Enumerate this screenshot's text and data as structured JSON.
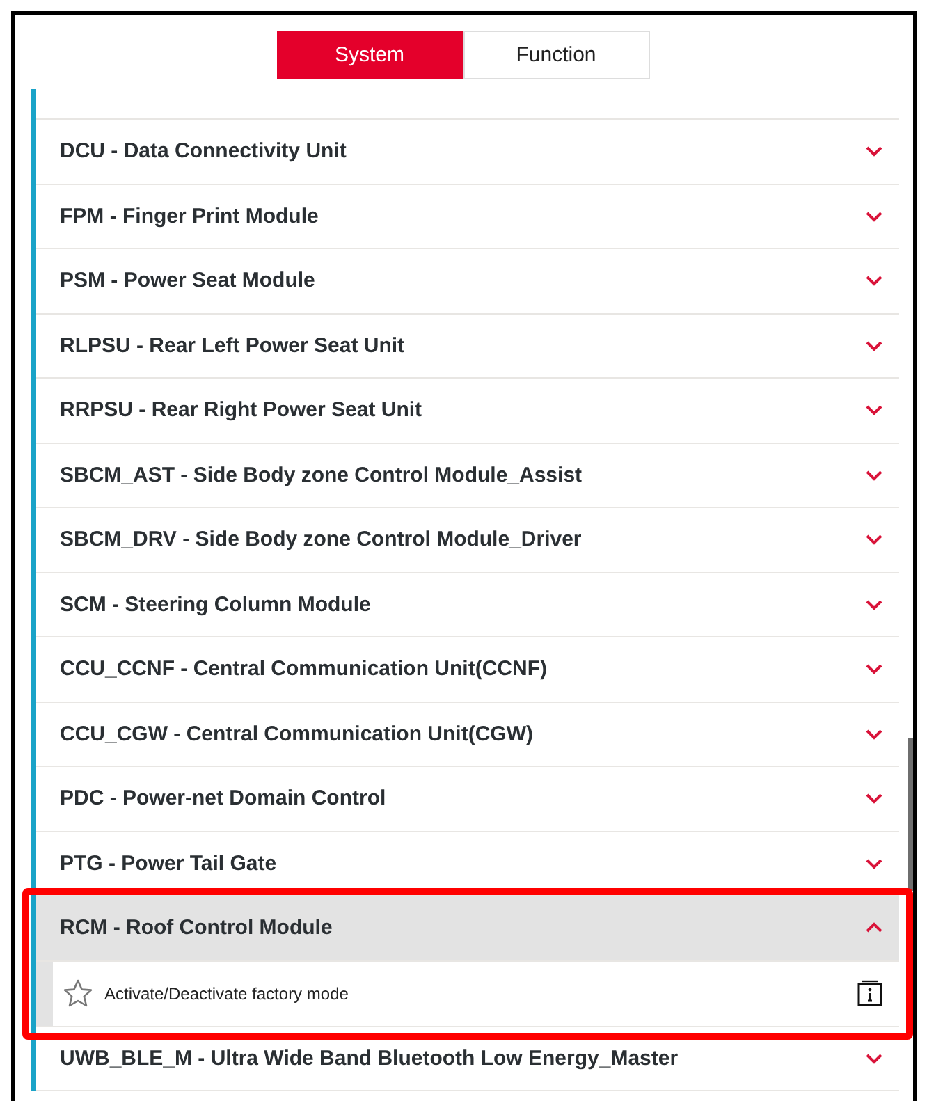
{
  "tabs": [
    {
      "label": "System",
      "selected": true
    },
    {
      "label": "Function",
      "selected": false
    }
  ],
  "modules": [
    {
      "name": "DCU - Data Connectivity Unit",
      "expanded": false
    },
    {
      "name": "FPM - Finger Print Module",
      "expanded": false
    },
    {
      "name": "PSM - Power Seat Module",
      "expanded": false
    },
    {
      "name": "RLPSU - Rear Left Power Seat Unit",
      "expanded": false
    },
    {
      "name": "RRPSU - Rear Right Power Seat Unit",
      "expanded": false
    },
    {
      "name": "SBCM_AST - Side Body zone Control Module_Assist",
      "expanded": false
    },
    {
      "name": "SBCM_DRV - Side Body zone Control Module_Driver",
      "expanded": false
    },
    {
      "name": "SCM - Steering Column Module",
      "expanded": false
    },
    {
      "name": "CCU_CCNF - Central Communication Unit(CCNF)",
      "expanded": false
    },
    {
      "name": "CCU_CGW - Central Communication Unit(CGW)",
      "expanded": false
    },
    {
      "name": "PDC - Power-net Domain Control",
      "expanded": false
    },
    {
      "name": "PTG - Power Tail Gate",
      "expanded": false
    },
    {
      "name": "RCM - Roof Control Module",
      "expanded": true,
      "functions": [
        {
          "label": "Activate/Deactivate factory mode",
          "favorite": false
        }
      ]
    },
    {
      "name": "UWB_BLE_M - Ultra Wide Band Bluetooth Low Energy_Master",
      "expanded": false
    }
  ]
}
